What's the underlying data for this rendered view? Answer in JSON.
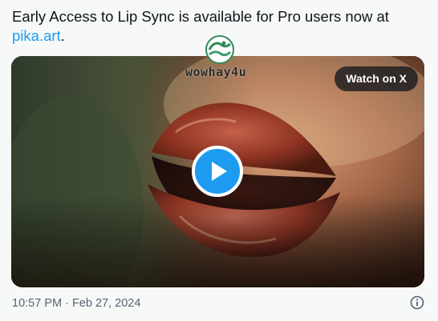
{
  "tweet": {
    "text_before": "Early Access to Lip Sync is available for Pro users now at ",
    "link_text": "pika.art",
    "text_after": "."
  },
  "media": {
    "watch_label": "Watch on X",
    "play_icon": "play-icon",
    "watermark_text": "wowhay4u",
    "watermark_logo_icon": "wave-logo-icon"
  },
  "footer": {
    "timestamp": "10:57 PM · Feb 27, 2024",
    "info_icon": "info-icon"
  },
  "colors": {
    "accent": "#1d9bf0",
    "text": "#0f1419",
    "muted": "#536471",
    "background": "#f7f9f9"
  }
}
